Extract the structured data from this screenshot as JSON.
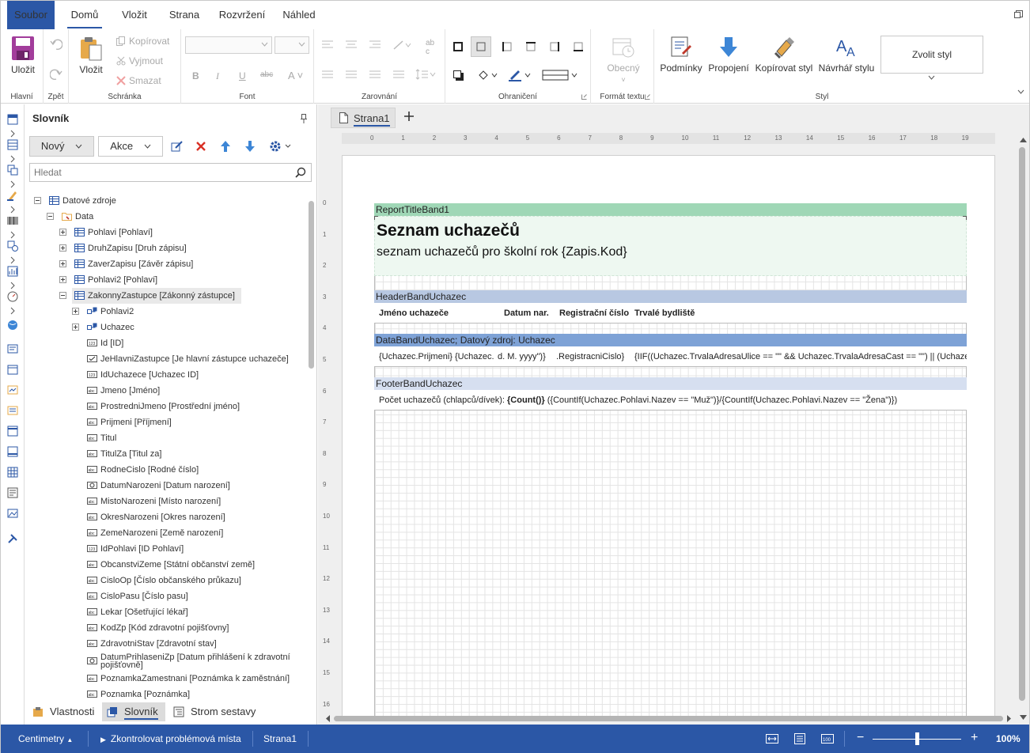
{
  "tabs": {
    "file": "Soubor",
    "home": "Domů",
    "insert": "Vložit",
    "page": "Strana",
    "layout": "Rozvržení",
    "preview": "Náhled"
  },
  "ribbon": {
    "main": {
      "save": "Uložit",
      "label": "Hlavní"
    },
    "undo": {
      "label": "Zpět"
    },
    "clipboard": {
      "paste": "Vložit",
      "copy": "Kopírovat",
      "cut": "Vyjmout",
      "delete": "Smazat",
      "label": "Schránka"
    },
    "font": {
      "bold": "B",
      "italic": "I",
      "underline": "U",
      "strike": "abc",
      "color": "A",
      "label": "Font"
    },
    "alignment": {
      "label": "Zarovnání"
    },
    "borders": {
      "label": "Ohraničení"
    },
    "textformat": {
      "general": "Obecný",
      "label": "Formát textu"
    },
    "style": {
      "conditions": "Podmínky",
      "links": "Propojení",
      "copy_style": "Kopírovat styl",
      "designer": "Návrhář stylu",
      "choose": "Zvolit styl",
      "label": "Styl"
    }
  },
  "dictionary": {
    "title": "Slovník",
    "new_btn": "Nový",
    "actions_btn": "Akce",
    "search_placeholder": "Hledat",
    "items": [
      {
        "label": "Datové zdroje",
        "indent": 0,
        "exp": "minus",
        "icon": "db"
      },
      {
        "label": "Data",
        "indent": 1,
        "exp": "minus",
        "icon": "folder"
      },
      {
        "label": "Pohlavi [Pohlaví]",
        "indent": 2,
        "exp": "plus",
        "icon": "table"
      },
      {
        "label": "DruhZapisu [Druh zápisu]",
        "indent": 2,
        "exp": "plus",
        "icon": "table"
      },
      {
        "label": "ZaverZapisu [Závěr zápisu]",
        "indent": 2,
        "exp": "plus",
        "icon": "table"
      },
      {
        "label": "Pohlavi2 [Pohlaví]",
        "indent": 2,
        "exp": "plus",
        "icon": "table"
      },
      {
        "label": "ZakonnyZastupce [Zákonný zástupce]",
        "indent": 2,
        "exp": "minus",
        "icon": "table",
        "selected": true
      },
      {
        "label": "Pohlavi2",
        "indent": 3,
        "exp": "plus",
        "icon": "relation"
      },
      {
        "label": "Uchazec",
        "indent": 3,
        "exp": "plus",
        "icon": "relation"
      },
      {
        "label": "Id [ID]",
        "indent": 3,
        "icon": "num"
      },
      {
        "label": "JeHlavniZastupce [Je hlavní zástupce uchazeče]",
        "indent": 3,
        "icon": "bool"
      },
      {
        "label": "IdUchazece [Uchazec ID]",
        "indent": 3,
        "icon": "num"
      },
      {
        "label": "Jmeno [Jméno]",
        "indent": 3,
        "icon": "str"
      },
      {
        "label": "ProstredniJmeno [Prostřední jméno]",
        "indent": 3,
        "icon": "str"
      },
      {
        "label": "Prijmeni [Příjmení]",
        "indent": 3,
        "icon": "str"
      },
      {
        "label": "Titul",
        "indent": 3,
        "icon": "str"
      },
      {
        "label": "TitulZa [Titul za]",
        "indent": 3,
        "icon": "str"
      },
      {
        "label": "RodneCislo [Rodné číslo]",
        "indent": 3,
        "icon": "str"
      },
      {
        "label": "DatumNarozeni [Datum narození]",
        "indent": 3,
        "icon": "date"
      },
      {
        "label": "MistoNarozeni [Místo narození]",
        "indent": 3,
        "icon": "str"
      },
      {
        "label": "OkresNarozeni [Okres narození]",
        "indent": 3,
        "icon": "str"
      },
      {
        "label": "ZemeNarozeni [Země narození]",
        "indent": 3,
        "icon": "str"
      },
      {
        "label": "IdPohlavi [ID Pohlaví]",
        "indent": 3,
        "icon": "num"
      },
      {
        "label": "ObcanstviZeme [Státní občanství země]",
        "indent": 3,
        "icon": "str"
      },
      {
        "label": "CisloOp [Číslo občanského průkazu]",
        "indent": 3,
        "icon": "str"
      },
      {
        "label": "CisloPasu [Číslo pasu]",
        "indent": 3,
        "icon": "str"
      },
      {
        "label": "Lekar [Ošetřující lékař]",
        "indent": 3,
        "icon": "str"
      },
      {
        "label": "KodZp [Kód zdravotní pojišťovny]",
        "indent": 3,
        "icon": "str"
      },
      {
        "label": "ZdravotniStav [Zdravotní stav]",
        "indent": 3,
        "icon": "str"
      },
      {
        "label": "DatumPrihlaseniZp [Datum přihlášení k zdravotní pojišťovně]",
        "indent": 3,
        "icon": "date"
      },
      {
        "label": "PoznamkaZamestnani [Poznámka k zaměstnání]",
        "indent": 3,
        "icon": "str"
      },
      {
        "label": "Poznamka [Poznámka]",
        "indent": 3,
        "icon": "str"
      }
    ]
  },
  "bottom_tabs": {
    "properties": "Vlastnosti",
    "dictionary": "Slovník",
    "report_tree": "Strom sestavy"
  },
  "designer": {
    "page_tab": "Strana1",
    "hruler": [
      "0",
      "1",
      "2",
      "3",
      "4",
      "5",
      "6",
      "7",
      "8",
      "9",
      "10",
      "11",
      "12",
      "13",
      "14",
      "15",
      "16",
      "17",
      "18",
      "19"
    ],
    "vruler": [
      "0",
      "1",
      "2",
      "3",
      "4",
      "5",
      "6",
      "7",
      "8",
      "9",
      "10",
      "11",
      "12",
      "13",
      "14",
      "15",
      "16"
    ]
  },
  "report": {
    "title_band": "ReportTitleBand1",
    "title": "Seznam uchazečů",
    "subtitle": "seznam uchazečů pro školní rok {Zapis.Kod}",
    "header_band": "HeaderBandUchazec",
    "header_cells": [
      "Jméno uchazeče",
      "Datum nar.",
      "Registrační číslo",
      "Trvalé bydliště"
    ],
    "data_band": "DataBandUchazec; Datový zdroj: Uchazec",
    "data_cells": [
      "{Uchazec.Prijmeni} {Uchazec.",
      "d. M. yyyy\")}",
      ".RegistracniCislo}",
      "{IIF((Uchazec.TrvalaAdresaUlice == \"\" && Uchazec.TrvalaAdresaCast == \"\") || (Uchaze"
    ],
    "footer_band": "FooterBandUchazec",
    "footer_prefix": "Počet uchazečů (chlapců/dívek): ",
    "footer_bold": "{Count()}",
    "footer_suffix": " ({CountIf(Uchazec.Pohlavi.Nazev == \"Muž\")}/{CountIf(Uchazec.Pohlavi.Nazev == \"Žena\")})"
  },
  "status": {
    "units": "Centimetry",
    "check": "Zkontrolovat problémová místa",
    "page": "Strana1",
    "zoom": "100%",
    "zoom_level": 1.0
  },
  "colors": {
    "accent": "#2b57a6",
    "title_band": "#9fd7b6",
    "title_band_body": "#eef8f1",
    "header_band": "#b8c8e2",
    "data_band": "#7ea2d6",
    "footer_band": "#d6dff0"
  }
}
